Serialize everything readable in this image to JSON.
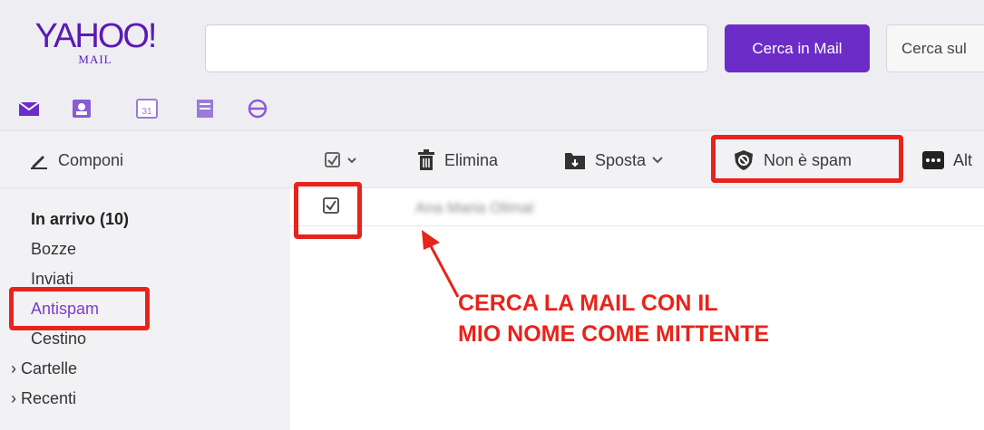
{
  "header": {
    "logo_main": "YAHOO!",
    "logo_sub": "MAIL",
    "search_placeholder": "",
    "search_mail_label": "Cerca in Mail",
    "search_web_label": "Cerca sul"
  },
  "app_icons": [
    "mail-icon",
    "contacts-icon",
    "calendar-icon",
    "notepad-icon",
    "messenger-icon"
  ],
  "calendar_day": "31",
  "toolbar": {
    "compose_label": "Componi",
    "delete_label": "Elimina",
    "move_label": "Sposta",
    "not_spam_label": "Non è spam",
    "more_label": "Alt"
  },
  "sidebar": {
    "inbox": "In arrivo (10)",
    "drafts": "Bozze",
    "sent": "Inviati",
    "spam": "Antispam",
    "trash": "Cestino",
    "folders": "Cartelle",
    "recent": "Recenti"
  },
  "message": {
    "sender": "Ana Maria Olimal"
  },
  "annotation": {
    "line1": "CERCA LA MAIL CON IL",
    "line2": "MIO NOME COME MITTENTE"
  },
  "colors": {
    "brand": "#5b1ab5",
    "button": "#6c2cc8",
    "highlight": "#e8231b"
  }
}
